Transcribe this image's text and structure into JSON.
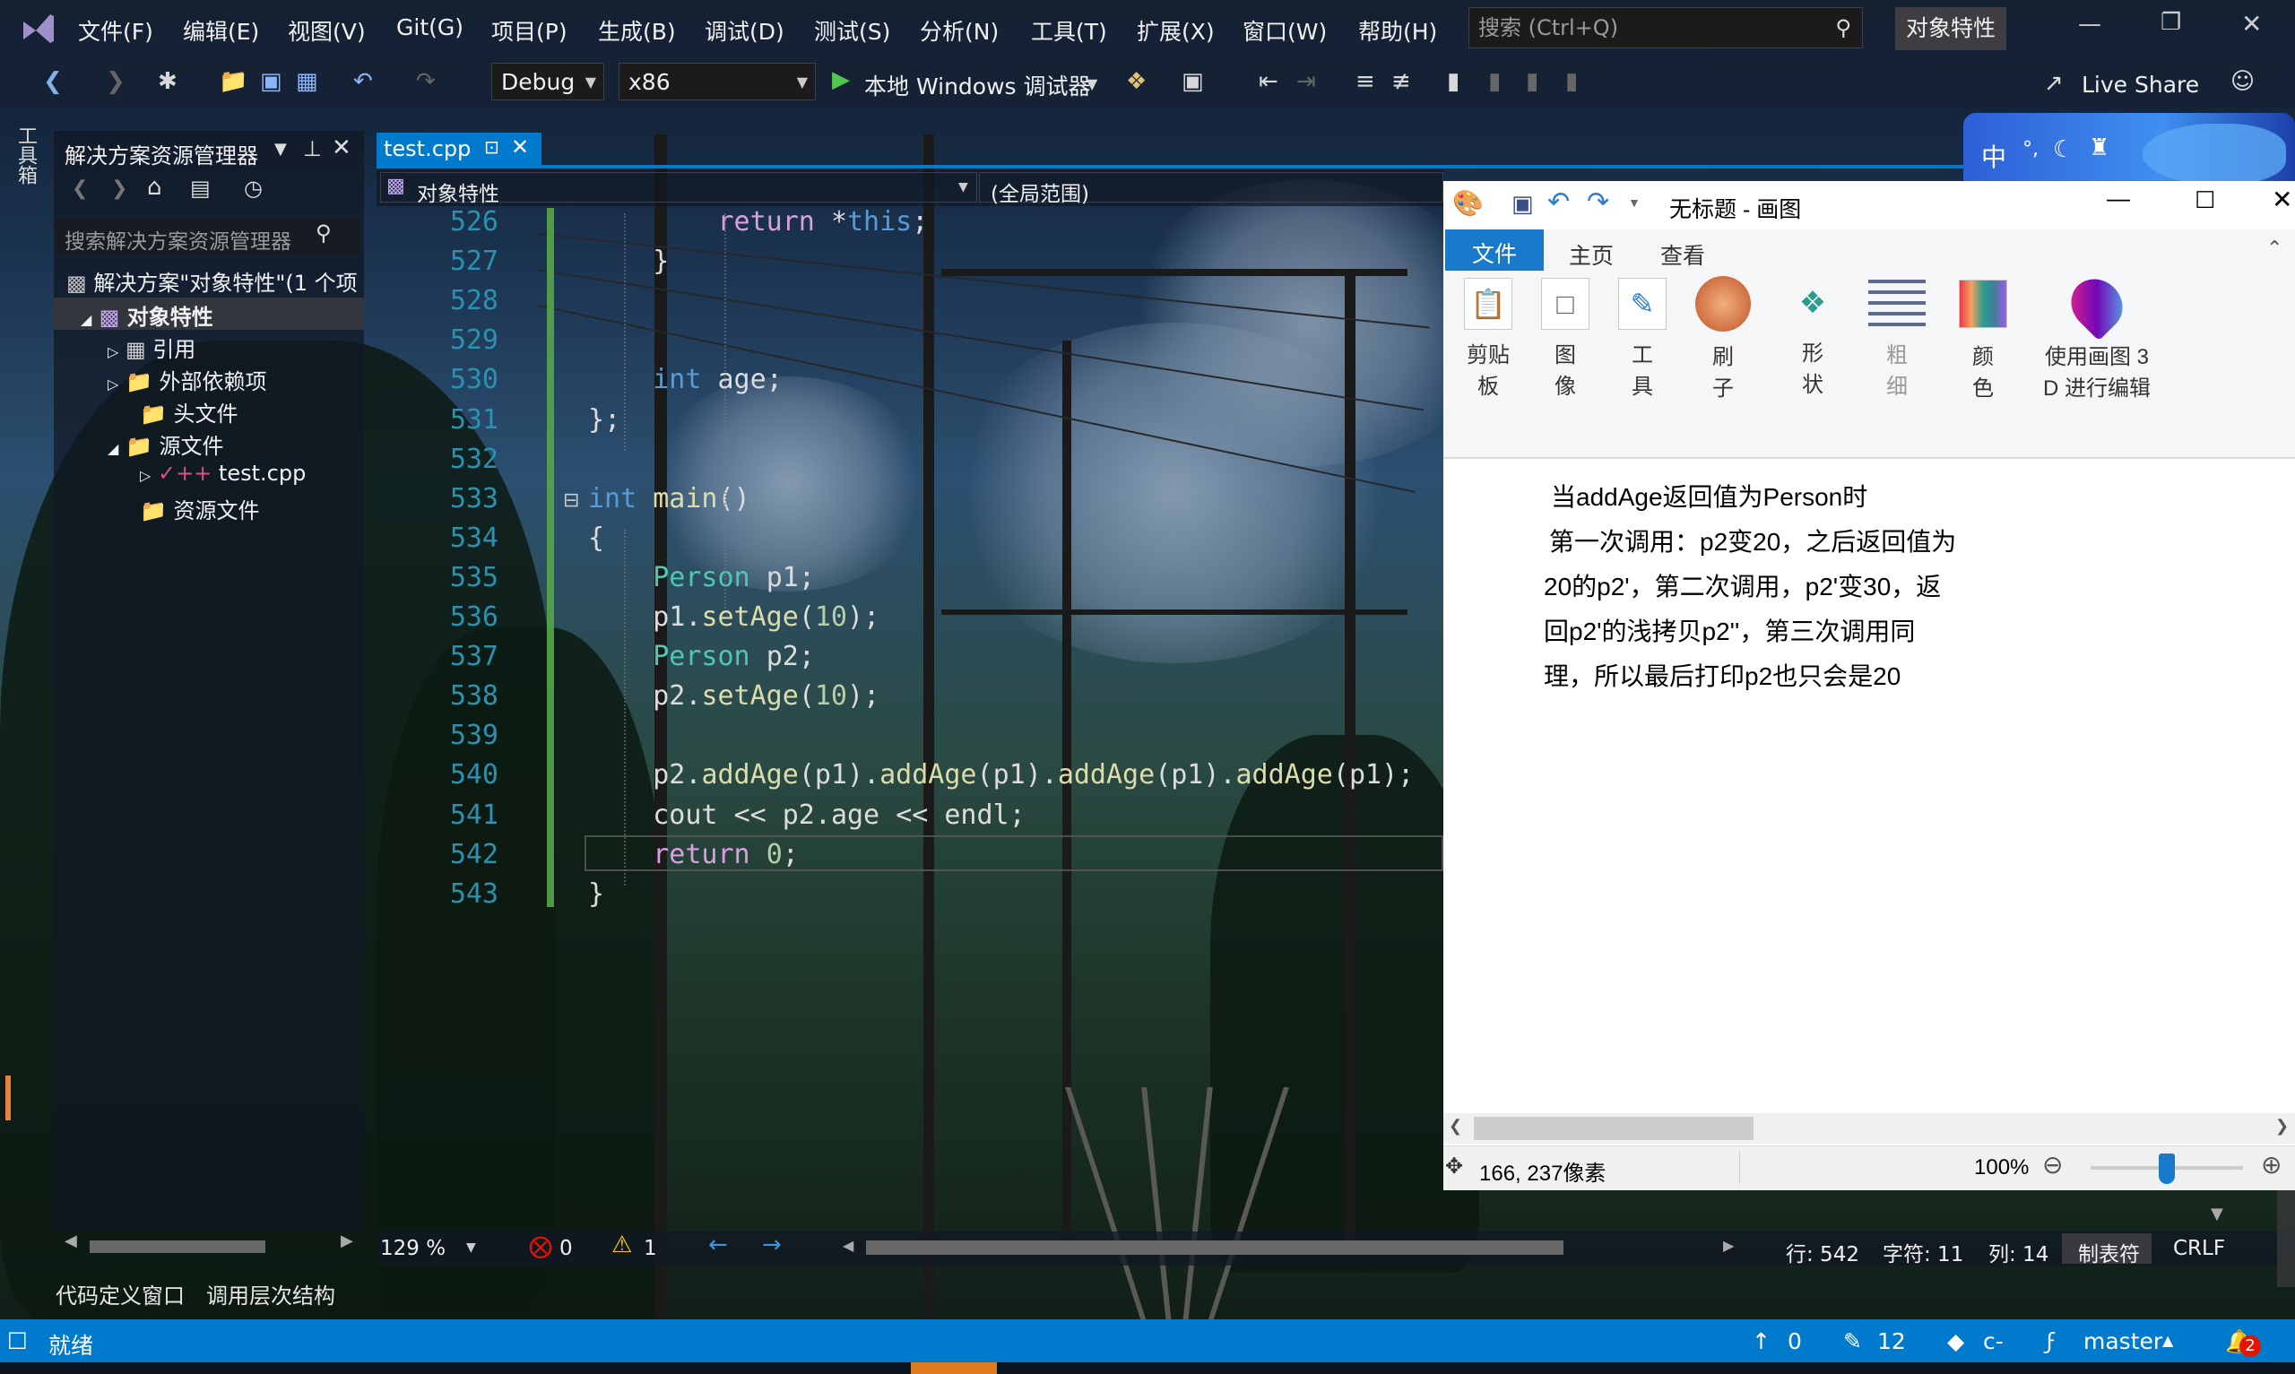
{
  "app": {
    "menu": [
      "文件(F)",
      "编辑(E)",
      "视图(V)",
      "Git(G)",
      "项目(P)",
      "生成(B)",
      "调试(D)",
      "测试(S)",
      "分析(N)",
      "工具(T)",
      "扩展(X)",
      "窗口(W)",
      "帮助(H)"
    ],
    "search_placeholder": "搜索 (Ctrl+Q)",
    "solution_badge": "对象特性",
    "config": "Debug",
    "platform": "x86",
    "run_label": "本地 Windows 调试器",
    "live_share": "Live Share",
    "toolbox_label": "工具箱"
  },
  "solution_explorer": {
    "title": "解决方案资源管理器",
    "search_placeholder": "搜索解决方案资源管理器",
    "solution": "解决方案\"对象特性\"(1 个项",
    "project": "对象特性",
    "items": [
      "引用",
      "外部依赖项",
      "头文件",
      "源文件",
      "test.cpp",
      "资源文件"
    ],
    "bottom_tabs": [
      "代码定义窗口",
      "调用层次结构"
    ]
  },
  "editor": {
    "tab": "test.cpp",
    "scope_left": "对象特性",
    "scope_right": "(全局范围)",
    "lines": [
      {
        "n": "526",
        "text": "        return *this;"
      },
      {
        "n": "527",
        "text": "    }"
      },
      {
        "n": "528",
        "text": ""
      },
      {
        "n": "529",
        "text": ""
      },
      {
        "n": "530",
        "text": "    int age;"
      },
      {
        "n": "531",
        "text": "};"
      },
      {
        "n": "532",
        "text": ""
      },
      {
        "n": "533",
        "text": "int main()"
      },
      {
        "n": "534",
        "text": "{"
      },
      {
        "n": "535",
        "text": "    Person p1;"
      },
      {
        "n": "536",
        "text": "    p1.setAge(10);"
      },
      {
        "n": "537",
        "text": "    Person p2;"
      },
      {
        "n": "538",
        "text": "    p2.setAge(10);"
      },
      {
        "n": "539",
        "text": ""
      },
      {
        "n": "540",
        "text": "    p2.addAge(p1).addAge(p1).addAge(p1).addAge(p1);"
      },
      {
        "n": "541",
        "text": "    cout << p2.age << endl;"
      },
      {
        "n": "542",
        "text": "    return 0;"
      },
      {
        "n": "543",
        "text": "}"
      }
    ],
    "zoom": "129 %",
    "errors": "0",
    "warnings": "1",
    "row": "行: 542",
    "char": "字符: 11",
    "col": "列: 14",
    "tab_mode": "制表符",
    "eol": "CRLF"
  },
  "paint": {
    "title": "无标题 - 画图",
    "tabs": [
      "文件",
      "主页",
      "查看"
    ],
    "ribbon": [
      {
        "l1": "剪贴",
        "l2": "板"
      },
      {
        "l1": "图",
        "l2": "像"
      },
      {
        "l1": "工",
        "l2": "具"
      },
      {
        "l1": "刷",
        "l2": "子"
      },
      {
        "l1": "形",
        "l2": "状"
      },
      {
        "l1": "粗",
        "l2": "细"
      },
      {
        "l1": "颜",
        "l2": "色"
      },
      {
        "l1": "使用画图 3",
        "l2": "D 进行编辑"
      }
    ],
    "note_lines": [
      "当addAge返回值为Person时",
      "第一次调用：p2变20，之后返回值为",
      "20的p2'，第二次调用，p2'变30，返",
      "回p2'的浅拷贝p2''，第三次调用同",
      "理，所以最后打印p2也只会是20"
    ],
    "cursor_pos": "166, 237像素",
    "zoom": "100%",
    "zoom_level": 0.5
  },
  "ime": {
    "label": "中"
  },
  "status": {
    "ready": "就绪",
    "up": "0",
    "edits": "12",
    "repo": "c-",
    "branch": "master",
    "notifications": "2"
  }
}
